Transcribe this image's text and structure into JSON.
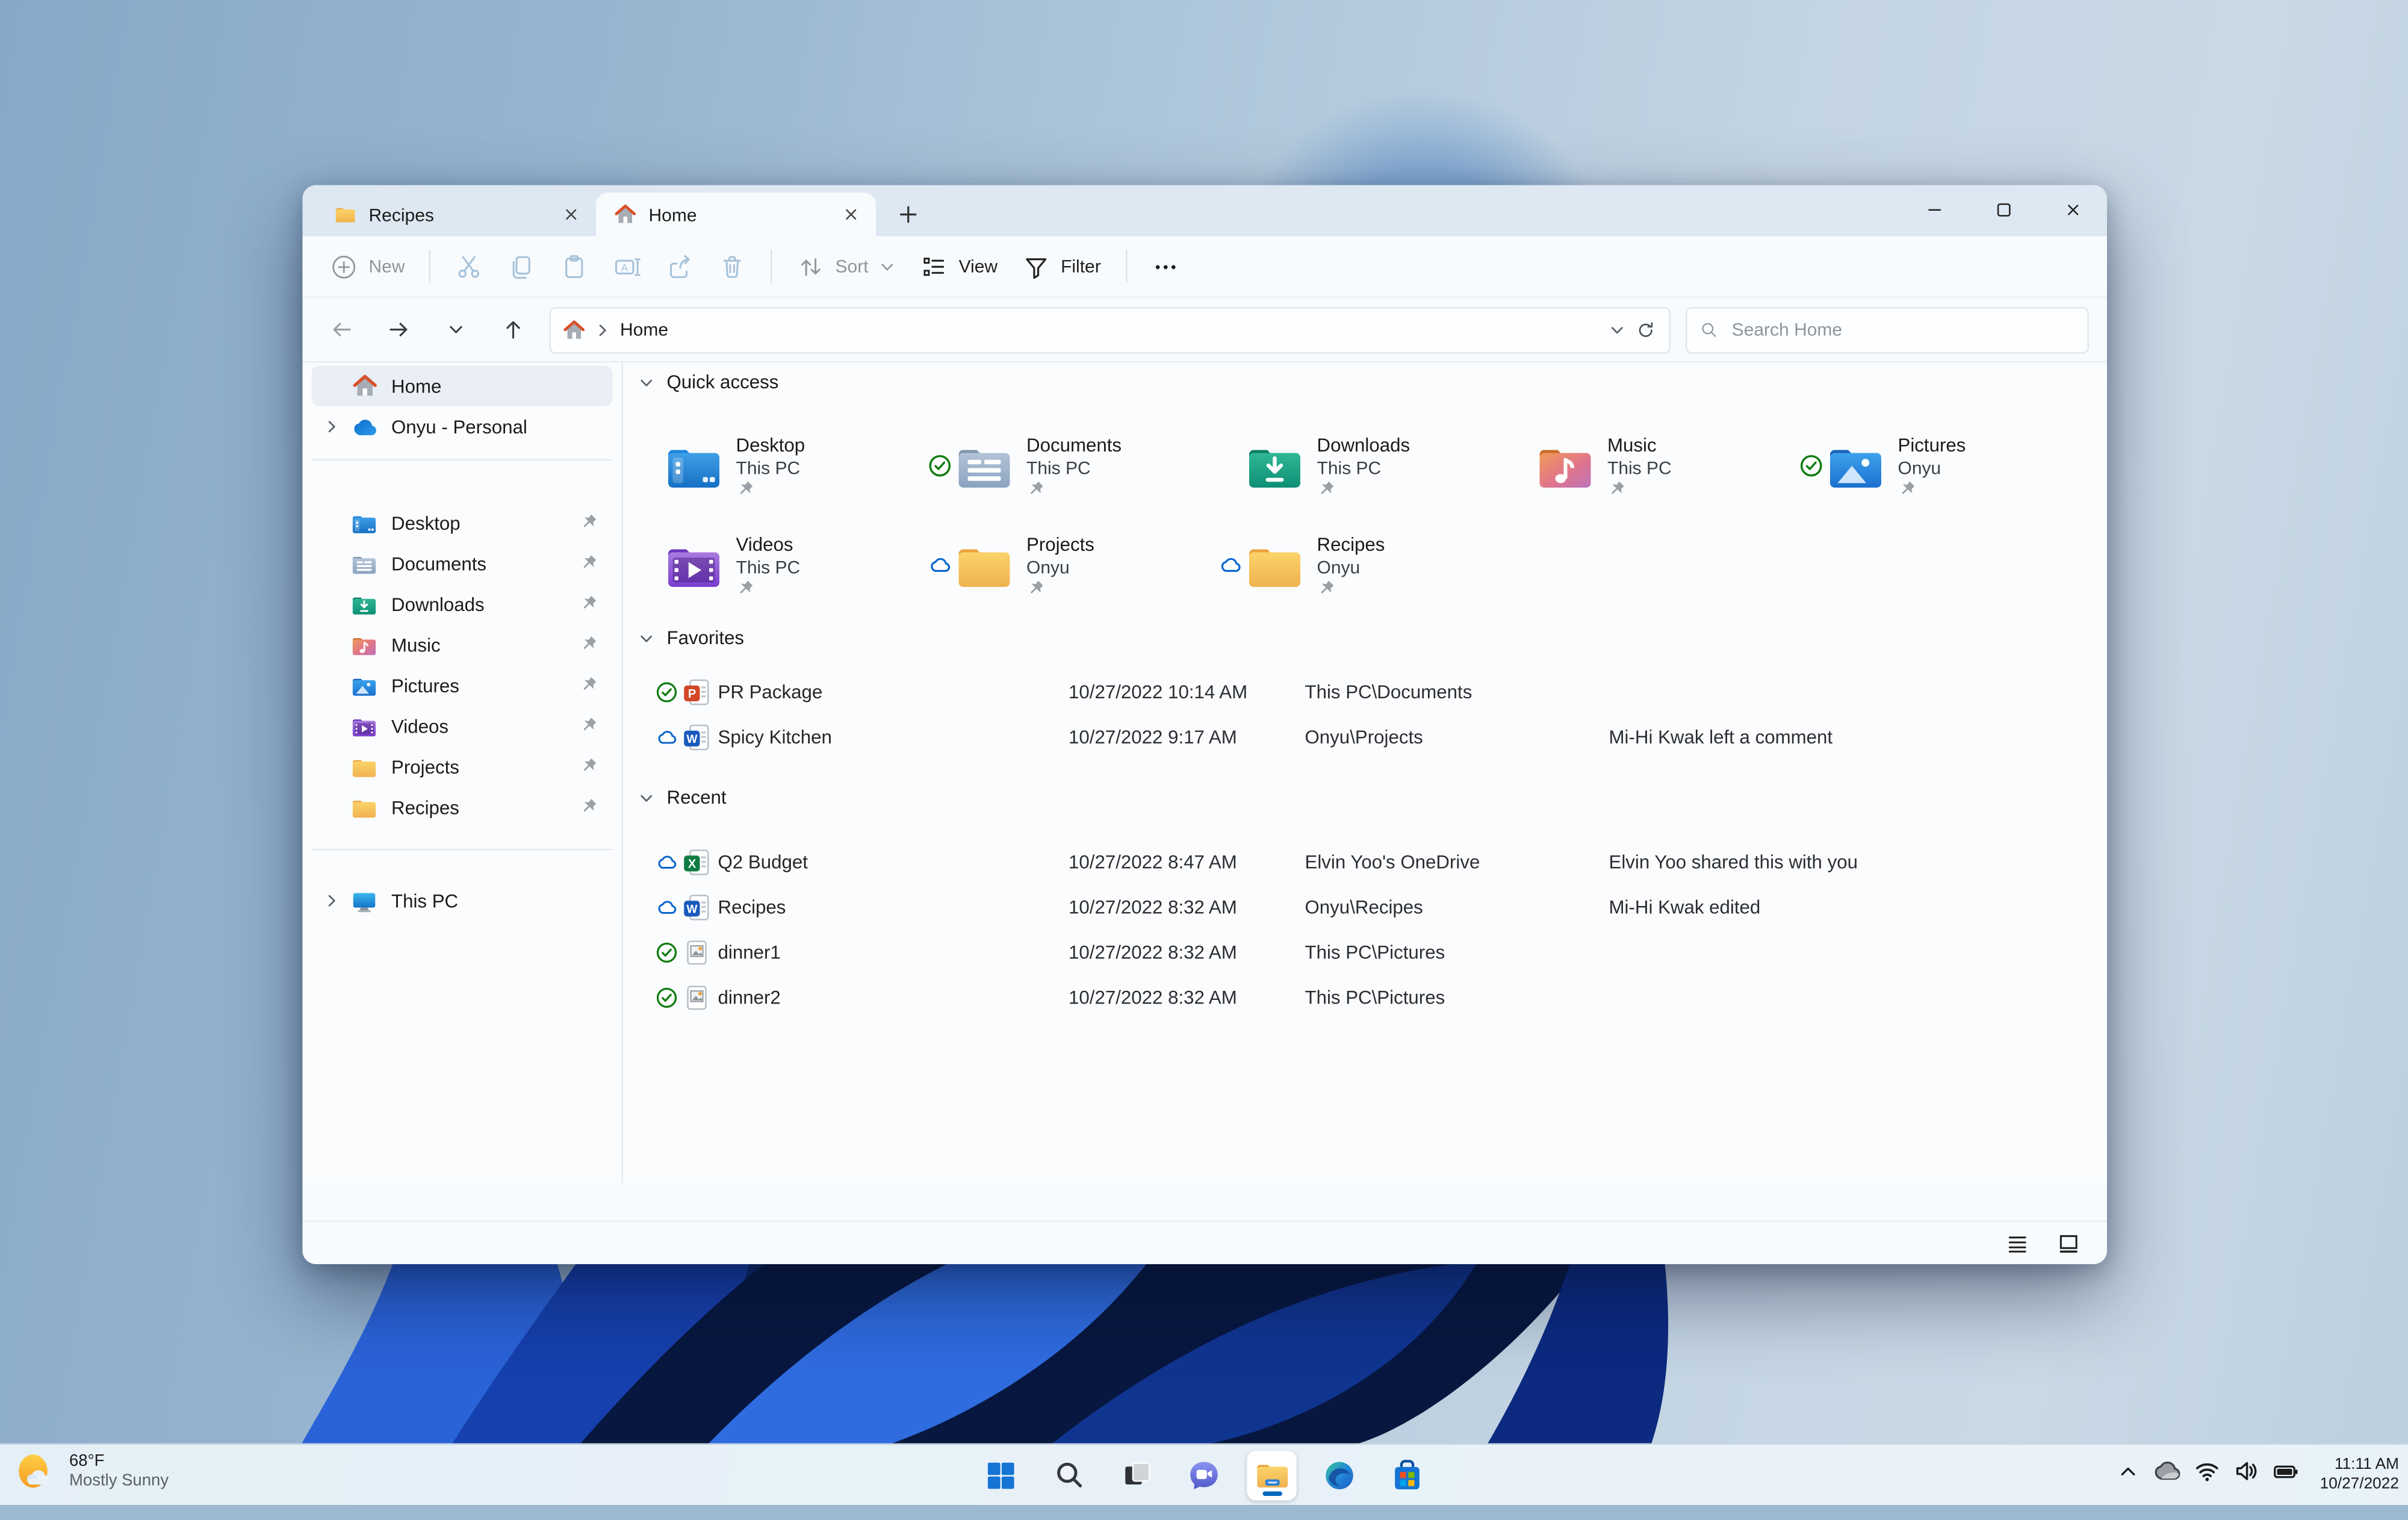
{
  "window": {
    "tabs": [
      {
        "label": "Recipes",
        "icon": "folder-icon",
        "active": false
      },
      {
        "label": "Home",
        "icon": "home-icon",
        "active": true
      }
    ],
    "toolbar": {
      "new_label": "New",
      "sort_label": "Sort",
      "view_label": "View",
      "filter_label": "Filter",
      "icons": [
        "plus-circle",
        "cut",
        "copy",
        "paste",
        "rename",
        "share",
        "delete",
        "sort-arrows",
        "view-list",
        "filter-funnel",
        "more-ellipsis"
      ]
    },
    "addressbar": {
      "path": "Home",
      "icons": [
        "back",
        "forward",
        "recent-locations-chevron",
        "up",
        "home",
        "breadcrumb-chevron",
        "dropdown-chevron",
        "refresh"
      ]
    },
    "search": {
      "placeholder": "Search Home"
    },
    "sidebar": {
      "items": [
        {
          "label": "Home"
        },
        {
          "label": "Onyu - Personal"
        },
        {
          "label": "Desktop",
          "pinned": true
        },
        {
          "label": "Documents",
          "pinned": true
        },
        {
          "label": "Downloads",
          "pinned": true
        },
        {
          "label": "Music",
          "pinned": true
        },
        {
          "label": "Pictures",
          "pinned": true
        },
        {
          "label": "Videos",
          "pinned": true
        },
        {
          "label": "Projects",
          "pinned": true
        },
        {
          "label": "Recipes",
          "pinned": true
        },
        {
          "label": "This PC"
        }
      ]
    },
    "quick_access": {
      "title": "Quick access",
      "tiles": [
        {
          "name": "Desktop",
          "location": "This PC",
          "badge": "",
          "pinned": true
        },
        {
          "name": "Documents",
          "location": "This PC",
          "badge": "synced",
          "pinned": true
        },
        {
          "name": "Downloads",
          "location": "This PC",
          "badge": "",
          "pinned": true
        },
        {
          "name": "Music",
          "location": "This PC",
          "badge": "",
          "pinned": true
        },
        {
          "name": "Pictures",
          "location": "Onyu",
          "badge": "synced",
          "pinned": true
        },
        {
          "name": "Videos",
          "location": "This PC",
          "badge": "",
          "pinned": true
        },
        {
          "name": "Projects",
          "location": "Onyu",
          "badge": "cloud",
          "pinned": true
        },
        {
          "name": "Recipes",
          "location": "Onyu",
          "badge": "cloud",
          "pinned": true
        }
      ]
    },
    "favorites": {
      "title": "Favorites",
      "rows": [
        {
          "name": "PR Package",
          "type": "powerpoint",
          "badge": "synced",
          "date": "10/27/2022 10:14 AM",
          "location": "This PC\\Documents",
          "activity": ""
        },
        {
          "name": "Spicy Kitchen",
          "type": "word",
          "badge": "cloud",
          "date": "10/27/2022 9:17 AM",
          "location": "Onyu\\Projects",
          "activity": "Mi-Hi Kwak left a comment"
        }
      ]
    },
    "recent": {
      "title": "Recent",
      "rows": [
        {
          "name": "Q2 Budget",
          "type": "excel",
          "badge": "cloud",
          "date": "10/27/2022 8:47 AM",
          "location": "Elvin Yoo's OneDrive",
          "activity": "Elvin Yoo shared this with you"
        },
        {
          "name": "Recipes",
          "type": "word",
          "badge": "cloud",
          "date": "10/27/2022 8:32 AM",
          "location": "Onyu\\Recipes",
          "activity": "Mi-Hi Kwak edited"
        },
        {
          "name": "dinner1",
          "type": "image",
          "badge": "synced",
          "date": "10/27/2022 8:32 AM",
          "location": "This PC\\Pictures",
          "activity": ""
        },
        {
          "name": "dinner2",
          "type": "image",
          "badge": "synced",
          "date": "10/27/2022 8:32 AM",
          "location": "This PC\\Pictures",
          "activity": ""
        }
      ]
    },
    "statusbar": {
      "icons": [
        "details-view",
        "large-thumbnails-view"
      ]
    }
  },
  "taskbar": {
    "weather": {
      "temp": "68°F",
      "condition": "Mostly Sunny"
    },
    "center_icons": [
      "start",
      "search",
      "task-view",
      "chat",
      "file-explorer",
      "edge",
      "store"
    ],
    "tray_icons": [
      "chevron-up",
      "onedrive",
      "wifi",
      "volume",
      "battery"
    ],
    "clock": {
      "time": "11:11 AM",
      "date": "10/27/2022"
    }
  },
  "colors": {
    "accent": "#0067c0",
    "sync_green": "#107c10",
    "cloud_blue": "#0b66cc",
    "taskbar_bg": "#ebf3fa"
  }
}
